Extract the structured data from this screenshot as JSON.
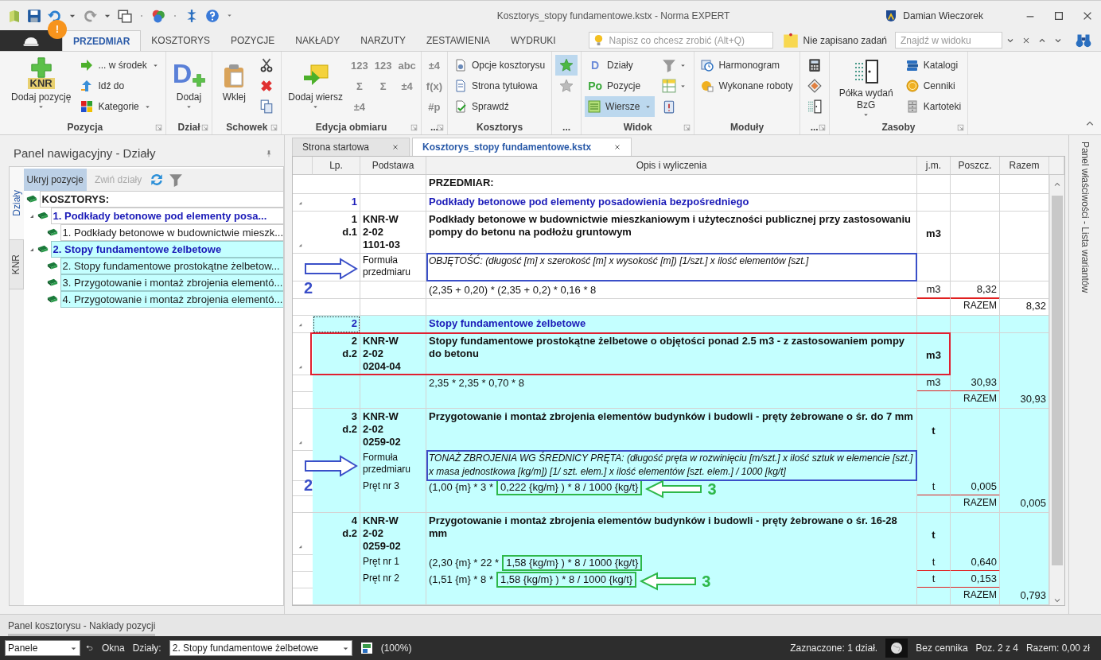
{
  "window": {
    "title": "Kosztorys_stopy fundamentowe.kstx - Norma EXPERT",
    "user": "Damian Wieczorek",
    "notification_badge": "!"
  },
  "ribbon_tabs": [
    {
      "label": "PRZEDMIAR",
      "selected": true
    },
    {
      "label": "KOSZTORYS",
      "selected": false
    },
    {
      "label": "POZYCJE",
      "selected": false
    },
    {
      "label": "NAKŁADY",
      "selected": false
    },
    {
      "label": "NARZUTY",
      "selected": false
    },
    {
      "label": "ZESTAWIENIA",
      "selected": false
    },
    {
      "label": "WYDRUKI",
      "selected": false
    }
  ],
  "tell_me": {
    "placeholder": "Napisz co chcesz zrobić (Alt+Q)"
  },
  "tasks": {
    "label": "Nie zapisano zadań"
  },
  "find": {
    "placeholder": "Znajdź w widoku"
  },
  "ribbon_groups": [
    {
      "title": "Pozycja",
      "launcher": true,
      "columns": [
        [
          {
            "kind": "large",
            "label": "Dodaj pozycję",
            "glyph": "KNR",
            "dropdown": true
          }
        ],
        [
          {
            "kind": "small",
            "label": "... w środek",
            "dropdown": true
          },
          {
            "kind": "small",
            "label": "Idź do",
            "dropdown": false
          },
          {
            "kind": "small",
            "label": "Kategorie",
            "dropdown": true
          }
        ]
      ]
    },
    {
      "title": "Dział",
      "launcher": true,
      "columns": [
        [
          {
            "kind": "large",
            "label": "Dodaj",
            "glyph": "D",
            "dropdown": true
          }
        ]
      ]
    },
    {
      "title": "Schowek",
      "launcher": true,
      "columns": [
        [
          {
            "kind": "large",
            "label": "Wklej",
            "dropdown": false
          }
        ],
        [
          {
            "kind": "icon"
          },
          {
            "kind": "icon"
          },
          {
            "kind": "icon"
          }
        ]
      ]
    },
    {
      "title": "Edycja obmiaru",
      "launcher": true,
      "columns": [
        [
          {
            "kind": "large",
            "label": "Dodaj wiersz",
            "dropdown": true
          }
        ],
        [
          {
            "kind": "glyph",
            "glyph": "123"
          },
          {
            "kind": "glyph",
            "glyph": "Σ"
          },
          {
            "kind": "glyph",
            "glyph": "±4"
          }
        ],
        [
          {
            "kind": "glyph",
            "glyph": "123"
          },
          {
            "kind": "glyph",
            "glyph": "Σ"
          }
        ],
        [
          {
            "kind": "glyph",
            "glyph": "abc"
          },
          {
            "kind": "glyph",
            "glyph": "±4"
          }
        ]
      ]
    },
    {
      "title": "...",
      "launcher": true,
      "columns": [
        [
          {
            "kind": "glyph",
            "glyph": "±4"
          },
          {
            "kind": "glyph",
            "glyph": "f(x)"
          },
          {
            "kind": "glyph",
            "glyph": "#p"
          }
        ]
      ]
    },
    {
      "title": "Kosztorys",
      "launcher": false,
      "columns": [
        [
          {
            "kind": "small",
            "label": "Opcje kosztorysu",
            "dropdown": false
          },
          {
            "kind": "small",
            "label": "Strona tytułowa",
            "dropdown": false
          },
          {
            "kind": "small",
            "label": "Sprawdź",
            "dropdown": false
          }
        ]
      ]
    },
    {
      "title": "...",
      "launcher": false,
      "columns": [
        [
          {
            "kind": "icon",
            "selected": true
          },
          {
            "kind": "icon",
            "selected": false
          }
        ]
      ]
    },
    {
      "title": "Widok",
      "launcher": true,
      "columns": [
        [
          {
            "kind": "small",
            "label": "Działy",
            "glyph": "D",
            "color": "#6a8ad8",
            "dropdown": false,
            "selected": false
          },
          {
            "kind": "small",
            "label": "Pozycje",
            "glyph": "Po",
            "color": "#3aa83a",
            "dropdown": false,
            "selected": false
          },
          {
            "kind": "small",
            "label": "Wiersze",
            "dropdown": true,
            "selected": true
          }
        ],
        [
          {
            "kind": "icon",
            "dropdown": true
          },
          {
            "kind": "icon",
            "dropdown": true
          },
          {
            "kind": "icon",
            "dropdown": false
          }
        ]
      ]
    },
    {
      "title": "Moduły",
      "launcher": false,
      "columns": [
        [
          {
            "kind": "small",
            "label": "Harmonogram",
            "dropdown": false
          },
          {
            "kind": "small",
            "label": "Wykonane roboty",
            "dropdown": false
          }
        ]
      ]
    },
    {
      "title": "...",
      "launcher": true,
      "columns": [
        [
          {
            "kind": "icon"
          },
          {
            "kind": "icon"
          },
          {
            "kind": "icon"
          }
        ]
      ]
    },
    {
      "title": "Zasoby",
      "launcher": true,
      "columns": [
        [
          {
            "kind": "large",
            "label": "Półka wydań BzG",
            "dropdown": true
          }
        ],
        [
          {
            "kind": "small",
            "label": "Katalogi",
            "dropdown": false
          },
          {
            "kind": "small",
            "label": "Cenniki",
            "dropdown": false
          },
          {
            "kind": "small",
            "label": "Kartoteki",
            "dropdown": false
          }
        ]
      ]
    }
  ],
  "nav_panel": {
    "title": "Panel nawigacyjny - Działy",
    "side_tabs": [
      {
        "label": "Działy",
        "selected": true
      },
      {
        "label": "KNR",
        "selected": false
      }
    ],
    "toolbar": [
      {
        "label": "Ukryj pozycje",
        "selected": true,
        "disabled": false
      },
      {
        "label": "Zwiń działy",
        "selected": false,
        "disabled": true
      }
    ],
    "tree": [
      {
        "label": "KOSZTORYS:",
        "highlighted": false,
        "children": [
          {
            "label": "1. Podkłady betonowe pod elementy posa...",
            "highlighted": false,
            "expanded": true,
            "children": [
              {
                "label": "1. Podkłady betonowe w budownictwie mieszk...",
                "highlighted": false
              }
            ]
          },
          {
            "label": "2. Stopy fundamentowe żelbetowe",
            "highlighted": true,
            "expanded": true,
            "children": [
              {
                "label": "2. Stopy fundamentowe prostokątne żelbetow...",
                "highlighted": true
              },
              {
                "label": "3. Przygotowanie i montaż zbrojenia elementó...",
                "highlighted": true
              },
              {
                "label": "4. Przygotowanie i montaż zbrojenia elementó...",
                "highlighted": true
              }
            ]
          }
        ]
      }
    ]
  },
  "doc_tabs": [
    {
      "label": "Strona startowa",
      "selected": false
    },
    {
      "label": "Kosztorys_stopy fundamentowe.kstx",
      "selected": true
    }
  ],
  "table": {
    "columns": [
      "Lp.",
      "Podstawa",
      "Opis i wyliczenia",
      "j.m.",
      "Poszcz.",
      "Razem"
    ],
    "rows": [
      {
        "kind": "title",
        "description": "PRZEDMIAR:",
        "highlighted": false
      },
      {
        "kind": "section",
        "lp": "1",
        "description": "Podkłady betonowe pod elementy posadowienia bezpośredniego",
        "highlighted": false,
        "expanded": true,
        "focused": false
      },
      {
        "kind": "position",
        "lp": "1\nd.1",
        "basis": "KNR-W\n2-02\n1101-03",
        "description": "Podkłady betonowe w budownictwie mieszkaniowym i użyteczności publicznej przy zastosowaniu pompy do betonu na podłożu gruntowym",
        "unit": "m3",
        "highlighted": false,
        "expanded": true,
        "framed": false
      },
      {
        "kind": "formula",
        "basis": "Formuła przedmiaru",
        "description": "OBJĘTOŚĆ: (długość [m] x szerokość [m] x wysokość [m]) [1/szt.] x ilość elementów [szt.]",
        "highlighted": false,
        "framed": true,
        "frame": {
          "color": "#3a4fc8"
        },
        "callout": {
          "kind": "formula",
          "label": "2"
        }
      },
      {
        "kind": "measure",
        "formula": "(2,35 + 0,20) * (2,35 + 0,2) * 0,16 * 8",
        "unit": "m3",
        "value": "8,32",
        "highlighted": false,
        "underlined": true
      },
      {
        "kind": "total",
        "label": "RAZEM",
        "value": "8,32",
        "highlighted": false
      },
      {
        "kind": "section",
        "lp": "2",
        "description": "Stopy fundamentowe żelbetowe",
        "highlighted": true,
        "expanded": true,
        "focused": true
      },
      {
        "kind": "position",
        "lp": "2\nd.2",
        "basis": "KNR-W\n2-02\n0204-04",
        "description": "Stopy fundamentowe prostokątne żelbetowe o objętości ponad 2.5 m3 - z zastosowaniem pompy do betonu",
        "unit": "m3",
        "highlighted": true,
        "expanded": true,
        "framed": true,
        "frame": {
          "color": "#e02030"
        }
      },
      {
        "kind": "measure",
        "formula": "2,35 * 2,35 * 0,70 * 8",
        "unit": "m3",
        "value": "30,93",
        "highlighted": true,
        "underlined": true
      },
      {
        "kind": "total",
        "label": "RAZEM",
        "value": "30,93",
        "highlighted": true
      },
      {
        "kind": "position",
        "lp": "3\nd.2",
        "basis": "KNR-W\n2-02\n0259-02",
        "description": "Przygotowanie i montaż zbrojenia elementów budynków i budowli - pręty żebrowane o śr. do 7 mm",
        "unit": "t",
        "highlighted": true,
        "expanded": true,
        "framed": false
      },
      {
        "kind": "formula",
        "basis": "Formuła przedmiaru",
        "description": "TONAŻ ZBROJENIA WG ŚREDNICY PRĘTA: (długość pręta w rozwinięciu [m/szt.] x ilość sztuk w elemencie [szt.] x masa jednostkowa [kg/m]) [1/ szt. elem.] x ilość elementów [szt. elem.] / 1000 [kg/t]",
        "highlighted": true,
        "framed": true,
        "frame": {
          "color": "#3a4fc8"
        },
        "callout": {
          "kind": "formula",
          "label": "2"
        }
      },
      {
        "kind": "measure",
        "basis": "Pręt nr 3",
        "formula": "(1,00 {m} * 3 *",
        "boxed": "0,222 {kg/m} ) * 8 / 1000 {kg/t}",
        "callout": {
          "kind": "factor",
          "label": "3"
        },
        "unit": "t",
        "value": "0,005",
        "highlighted": true,
        "underlined": true
      },
      {
        "kind": "total",
        "label": "RAZEM",
        "value": "0,005",
        "highlighted": true
      },
      {
        "kind": "position",
        "lp": "4\nd.2",
        "basis": "KNR-W\n2-02\n0259-02",
        "description": "Przygotowanie i montaż zbrojenia elementów budynków i budowli - pręty żebrowane o śr. 16-28 mm",
        "unit": "t",
        "highlighted": true,
        "expanded": true,
        "framed": false
      },
      {
        "kind": "measure",
        "basis": "Pręt nr 1",
        "formula": "(2,30 {m} * 22 *",
        "boxed": "1,58 {kg/m} ) * 8 / 1000 {kg/t}",
        "unit": "t",
        "value": "0,640",
        "highlighted": true,
        "underlined": true
      },
      {
        "kind": "measure",
        "basis": "Pręt nr 2",
        "formula": "(1,51 {m} * 8 *",
        "boxed": "1,58 {kg/m} ) * 8 / 1000 {kg/t}",
        "callout": {
          "kind": "factor",
          "label": "3"
        },
        "unit": "t",
        "value": "0,153",
        "highlighted": true,
        "underlined": true
      },
      {
        "kind": "total",
        "label": "RAZEM",
        "value": "0,793",
        "highlighted": true
      }
    ]
  },
  "right_panel": {
    "label": "Panel właściwości - Lista wariantów"
  },
  "bottom_panel": {
    "label": "Panel kosztorysu - Nakłady pozycji"
  },
  "status_bar": {
    "panels": "Panele",
    "windows": "Okna",
    "sections_label": "Działy:",
    "sections_value": "2. Stopy fundamentowe żelbetowe",
    "zoom": "(100%)",
    "selection": "Zaznaczone: 1 dział.",
    "pricing": "Bez cennika",
    "position": "Poz. 2 z 4",
    "total": "Razem: 0,00 zł"
  }
}
